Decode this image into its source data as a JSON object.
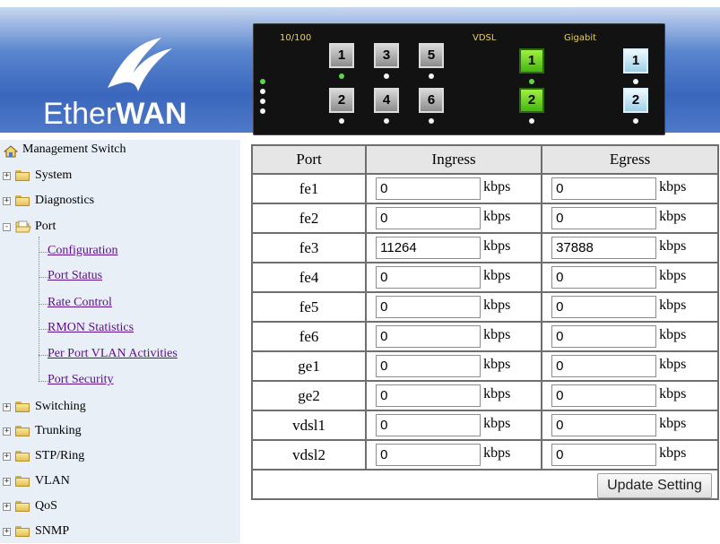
{
  "brand": {
    "logo_text_a": "Ether",
    "logo_text_b": "WAN"
  },
  "panel": {
    "label_10_100": "10/100",
    "label_vdsl": "VDSL",
    "label_gigabit": "Gigabit",
    "ports_top": [
      "1",
      "3",
      "5"
    ],
    "ports_bottom": [
      "2",
      "4",
      "6"
    ],
    "vdsl_top": "1",
    "vdsl_bottom": "2",
    "gig_top": "1",
    "gig_bottom": "2",
    "colors": {
      "gray_port": "#a8a8a8",
      "vdsl_port": "#6ad62a",
      "gigabit_port": "#c8e8f6",
      "led_on": "#5cd64a"
    }
  },
  "sidebar": {
    "root": "Management Switch",
    "items": [
      {
        "label": "System",
        "expander": "+"
      },
      {
        "label": "Diagnostics",
        "expander": "+"
      },
      {
        "label": "Port",
        "expander": "-"
      },
      {
        "label": "Switching",
        "expander": "+"
      },
      {
        "label": "Trunking",
        "expander": "+"
      },
      {
        "label": "STP/Ring",
        "expander": "+"
      },
      {
        "label": "VLAN",
        "expander": "+"
      },
      {
        "label": "QoS",
        "expander": "+"
      },
      {
        "label": "SNMP",
        "expander": "+"
      }
    ],
    "port_children": [
      "Configuration",
      "Port Status",
      "Rate Control",
      "RMON Statistics",
      "Per Port VLAN Activities",
      "Port Security"
    ]
  },
  "table": {
    "headers": [
      "Port",
      "Ingress",
      "Egress"
    ],
    "unit": "kbps",
    "rows": [
      {
        "port": "fe1",
        "ingress": "0",
        "egress": "0"
      },
      {
        "port": "fe2",
        "ingress": "0",
        "egress": "0"
      },
      {
        "port": "fe3",
        "ingress": "11264",
        "egress": "37888"
      },
      {
        "port": "fe4",
        "ingress": "0",
        "egress": "0"
      },
      {
        "port": "fe5",
        "ingress": "0",
        "egress": "0"
      },
      {
        "port": "fe6",
        "ingress": "0",
        "egress": "0"
      },
      {
        "port": "ge1",
        "ingress": "0",
        "egress": "0"
      },
      {
        "port": "ge2",
        "ingress": "0",
        "egress": "0"
      },
      {
        "port": "vdsl1",
        "ingress": "0",
        "egress": "0"
      },
      {
        "port": "vdsl2",
        "ingress": "0",
        "egress": "0"
      }
    ],
    "update_button": "Update Setting"
  }
}
